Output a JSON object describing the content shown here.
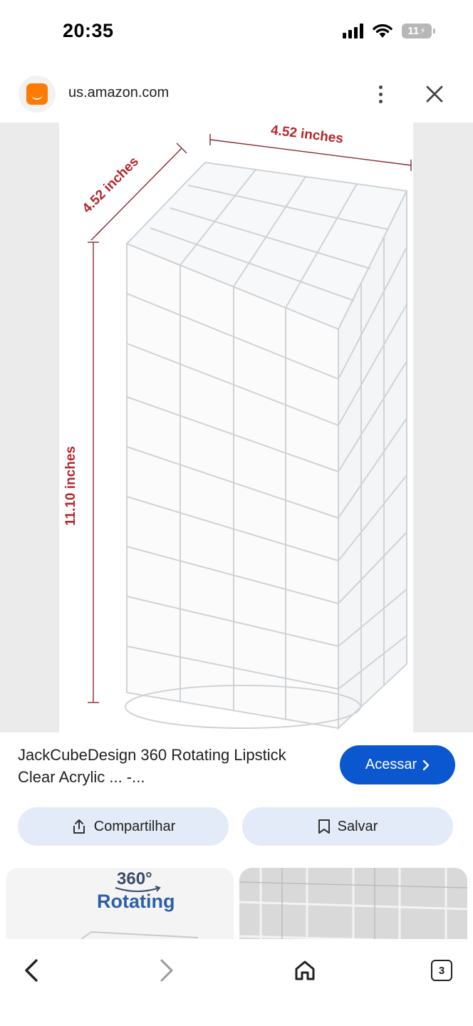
{
  "status_bar": {
    "time": "20:35",
    "battery_level": "11",
    "icons": [
      "cellular-signal-icon",
      "wifi-icon",
      "battery-charging-icon"
    ]
  },
  "header": {
    "domain": "us.amazon.com",
    "logo": "amazon-logo-icon",
    "more_icon": "more-vert-icon",
    "close_icon": "close-icon"
  },
  "image": {
    "dimension_width": "4.52 inches",
    "dimension_depth": "4.52 inches",
    "dimension_height": "11.10 inches",
    "dimension_color": "#b5262b"
  },
  "product": {
    "title": "JackCubeDesign 360 Rotating Lipstick Clear Acrylic ... -..."
  },
  "actions": {
    "visit_label": "Acessar",
    "share_label": "Compartilhar",
    "save_label": "Salvar",
    "accent": "#0b57d0",
    "pill_background": "#e3ebf8"
  },
  "related": {
    "thumb1_badge": "360°",
    "thumb1_text": "Rotating"
  },
  "bottom_nav": {
    "tab_count": "3",
    "icons": [
      "back-arrow-icon",
      "forward-arrow-icon",
      "home-icon",
      "tabs-icon"
    ]
  }
}
